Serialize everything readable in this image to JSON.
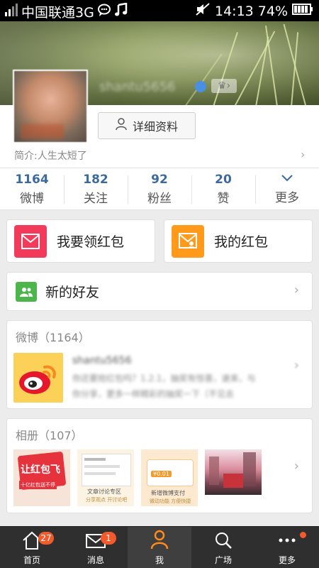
{
  "status_bar": {
    "carrier": "中国联通3G",
    "time": "14:13",
    "battery": "74%"
  },
  "profile": {
    "nickname": "shantu5656",
    "detail_button": "详细资料",
    "bio": "简介:人生太短了"
  },
  "stats": [
    {
      "num": "1164",
      "label": "微博"
    },
    {
      "num": "182",
      "label": "关注"
    },
    {
      "num": "92",
      "label": "粉丝"
    },
    {
      "num": "20",
      "label": "赞"
    },
    {
      "num": "",
      "label": "更多"
    }
  ],
  "red_packets": {
    "get": "我要领红包",
    "mine": "我的红包"
  },
  "new_friends": "新的好友",
  "weibo_section": {
    "title": "微博",
    "count": "（1164）",
    "author": "shantu5656",
    "snippet_line1": "你还要抢红包吗？1.2.1，抽奖有惊喜，速来，与",
    "snippet_line2": "你分享，更多一样精彩的抽奖一下（不见去"
  },
  "album_section": {
    "title": "相册",
    "count": "（107）",
    "thumbs": [
      {
        "caption": "让红包飞",
        "sub": "十亿红包送不停"
      },
      {
        "caption": "文章讨论专区",
        "sub": "分享观点 开讨论吧"
      },
      {
        "caption": "新增微博支付",
        "sub": "微动功能 方便快捷",
        "amount": "¥0.01"
      },
      {
        "caption": "",
        "sub": ""
      }
    ]
  },
  "tabs": [
    {
      "label": "首页",
      "badge": "27"
    },
    {
      "label": "消息",
      "badge": "1"
    },
    {
      "label": "我",
      "badge": ""
    },
    {
      "label": "广场",
      "badge": ""
    },
    {
      "label": "更多",
      "badge": ""
    }
  ],
  "colors": {
    "accent_blue": "#3c6a9c",
    "badge_orange": "#f25a2b",
    "red_packet_pink": "#f23a5a",
    "red_packet_orange": "#ff9a1a",
    "friend_green": "#4cb54c",
    "active_tab": "#ff8c1a"
  }
}
